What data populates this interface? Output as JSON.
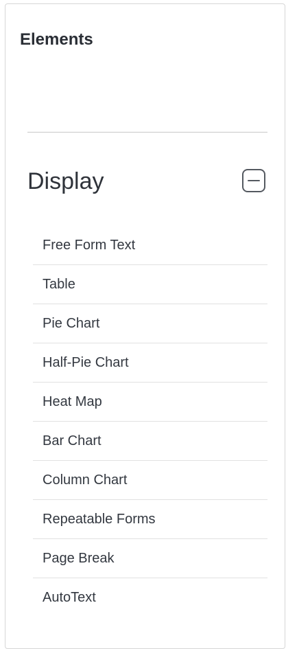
{
  "panel": {
    "title": "Elements"
  },
  "section": {
    "title": "Display",
    "collapse_icon": "minus-square-icon",
    "items": [
      {
        "label": "Free Form Text"
      },
      {
        "label": "Table"
      },
      {
        "label": "Pie Chart"
      },
      {
        "label": "Half-Pie Chart"
      },
      {
        "label": "Heat Map"
      },
      {
        "label": "Bar Chart"
      },
      {
        "label": "Column Chart"
      },
      {
        "label": "Repeatable Forms"
      },
      {
        "label": "Page Break"
      },
      {
        "label": "AutoText"
      }
    ]
  },
  "colors": {
    "text": "#2d3138",
    "border": "#d6d6d6",
    "divider": "#c8c8c8",
    "icon": "#545960"
  }
}
